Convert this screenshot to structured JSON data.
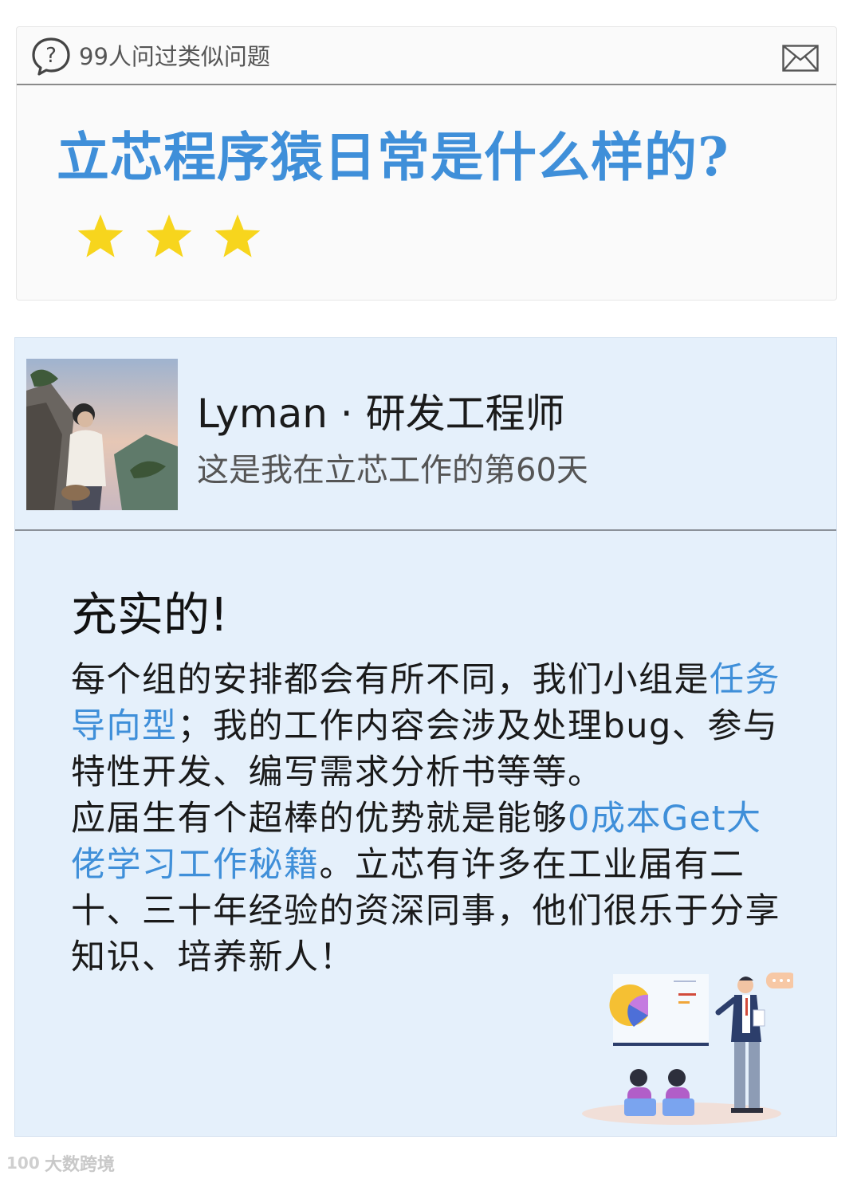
{
  "question": {
    "asked_count_text": "99人问过类似问题",
    "title": "立芯程序猿日常是什么样的?",
    "rating_stars": 3,
    "icons": [
      "question-bubble-icon",
      "mail-icon",
      "star-icon"
    ],
    "title_color": "#3f8fd9",
    "star_color": "#f7d51d"
  },
  "answer": {
    "author_name": "Lyman · 研发工程师",
    "author_subtitle": "这是我在立芯工作的第60天",
    "heading": "充实的!",
    "paragraph1": {
      "part1": "每个组的安排都会有所不同，我们小组是",
      "highlight": "任务导向型",
      "part2": "；我的工作内容会涉及处理bug、参与特性开发、编写需求分析书等等。"
    },
    "paragraph2": {
      "part1": "应届生有个超棒的优势就是能够",
      "highlight": "0成本Get大佬学习工作秘籍",
      "part2": "。立芯有许多在工业届有二十、三十年经验的资深同事，他们很乐于分享知识、培养新人！"
    }
  },
  "watermark": {
    "logo_text": "100",
    "text": "大数跨境"
  }
}
